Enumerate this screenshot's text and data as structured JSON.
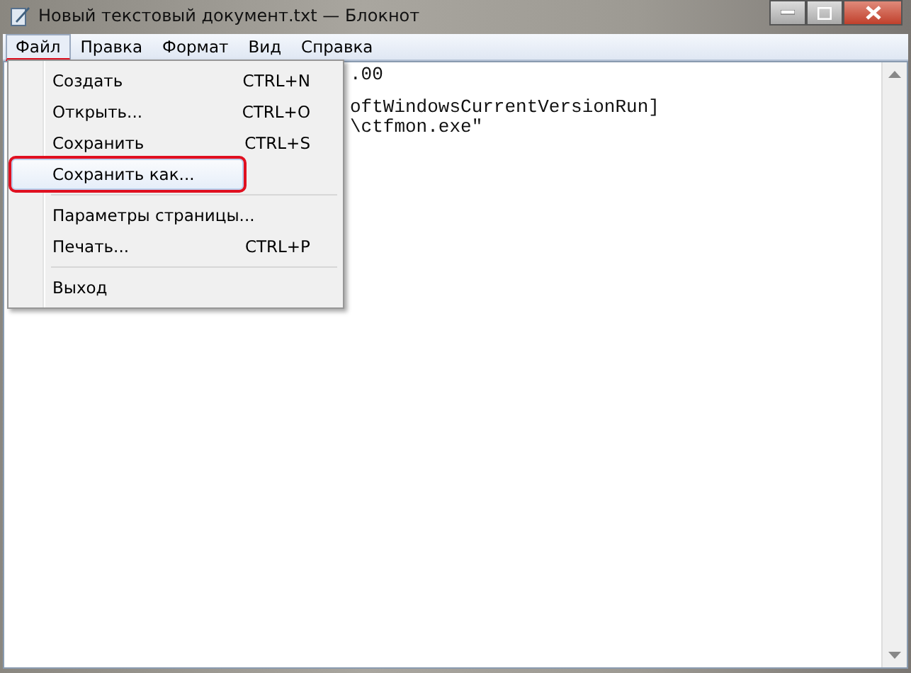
{
  "window": {
    "title": "Новый текстовый документ.txt — Блокнот"
  },
  "menubar": [
    {
      "label": "Файл",
      "selected": true,
      "highlighted": true
    },
    {
      "label": "Правка",
      "selected": false,
      "highlighted": false
    },
    {
      "label": "Формат",
      "selected": false,
      "highlighted": false
    },
    {
      "label": "Вид",
      "selected": false,
      "highlighted": false
    },
    {
      "label": "Справка",
      "selected": false,
      "highlighted": false
    }
  ],
  "menu": {
    "items": [
      {
        "kind": "item",
        "label": "Создать",
        "shortcut": "CTRL+N",
        "selected": false,
        "highlighted": false
      },
      {
        "kind": "item",
        "label": "Открыть...",
        "shortcut": "CTRL+O",
        "selected": false,
        "highlighted": false
      },
      {
        "kind": "item",
        "label": "Сохранить",
        "shortcut": "CTRL+S",
        "selected": false,
        "highlighted": false
      },
      {
        "kind": "item",
        "label": "Сохранить как...",
        "selected": true,
        "highlighted": true
      },
      {
        "kind": "separator"
      },
      {
        "kind": "item",
        "label": "Параметры страницы...",
        "selected": false,
        "highlighted": false
      },
      {
        "kind": "item",
        "label": "Печать...",
        "shortcut": "CTRL+P",
        "selected": false,
        "highlighted": false
      },
      {
        "kind": "separator"
      },
      {
        "kind": "item",
        "label": "Выход",
        "selected": false,
        "highlighted": false
      }
    ]
  },
  "editor": {
    "lines": [
      ".00",
      "oftWindowsCurrentVersionRun]",
      "\\ctfmon.exe\""
    ]
  }
}
